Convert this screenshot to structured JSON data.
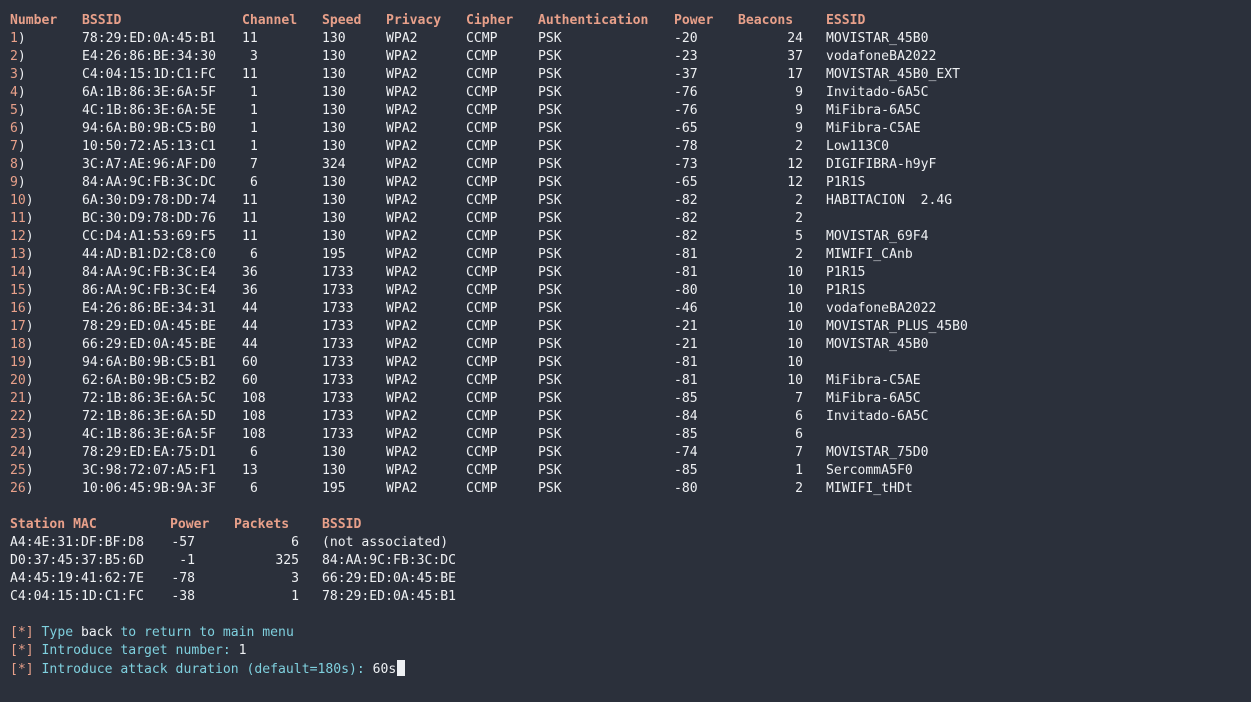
{
  "networks_header": {
    "number": "Number",
    "bssid": "BSSID",
    "channel": "Channel",
    "speed": "Speed",
    "privacy": "Privacy",
    "cipher": "Cipher",
    "authentication": "Authentication",
    "power": "Power",
    "beacons": "Beacons",
    "essid": "ESSID"
  },
  "networks": [
    {
      "number": "1",
      "bssid": "78:29:ED:0A:45:B1",
      "channel": "11",
      "speed": "130",
      "privacy": "WPA2",
      "cipher": "CCMP",
      "auth": "PSK",
      "power": "-20",
      "beacons": "24",
      "essid": "MOVISTAR_45B0"
    },
    {
      "number": "2",
      "bssid": "E4:26:86:BE:34:30",
      "channel": "3",
      "speed": "130",
      "privacy": "WPA2",
      "cipher": "CCMP",
      "auth": "PSK",
      "power": "-23",
      "beacons": "37",
      "essid": "vodafoneBA2022"
    },
    {
      "number": "3",
      "bssid": "C4:04:15:1D:C1:FC",
      "channel": "11",
      "speed": "130",
      "privacy": "WPA2",
      "cipher": "CCMP",
      "auth": "PSK",
      "power": "-37",
      "beacons": "17",
      "essid": "MOVISTAR_45B0_EXT"
    },
    {
      "number": "4",
      "bssid": "6A:1B:86:3E:6A:5F",
      "channel": "1",
      "speed": "130",
      "privacy": "WPA2",
      "cipher": "CCMP",
      "auth": "PSK",
      "power": "-76",
      "beacons": "9",
      "essid": "Invitado-6A5C"
    },
    {
      "number": "5",
      "bssid": "4C:1B:86:3E:6A:5E",
      "channel": "1",
      "speed": "130",
      "privacy": "WPA2",
      "cipher": "CCMP",
      "auth": "PSK",
      "power": "-76",
      "beacons": "9",
      "essid": "MiFibra-6A5C"
    },
    {
      "number": "6",
      "bssid": "94:6A:B0:9B:C5:B0",
      "channel": "1",
      "speed": "130",
      "privacy": "WPA2",
      "cipher": "CCMP",
      "auth": "PSK",
      "power": "-65",
      "beacons": "9",
      "essid": "MiFibra-C5AE"
    },
    {
      "number": "7",
      "bssid": "10:50:72:A5:13:C1",
      "channel": "1",
      "speed": "130",
      "privacy": "WPA2",
      "cipher": "CCMP",
      "auth": "PSK",
      "power": "-78",
      "beacons": "2",
      "essid": "Low113C0"
    },
    {
      "number": "8",
      "bssid": "3C:A7:AE:96:AF:D0",
      "channel": "7",
      "speed": "324",
      "privacy": "WPA2",
      "cipher": "CCMP",
      "auth": "PSK",
      "power": "-73",
      "beacons": "12",
      "essid": "DIGIFIBRA-h9yF"
    },
    {
      "number": "9",
      "bssid": "84:AA:9C:FB:3C:DC",
      "channel": "6",
      "speed": "130",
      "privacy": "WPA2",
      "cipher": "CCMP",
      "auth": "PSK",
      "power": "-65",
      "beacons": "12",
      "essid": "P1R1S"
    },
    {
      "number": "10",
      "bssid": "6A:30:D9:78:DD:74",
      "channel": "11",
      "speed": "130",
      "privacy": "WPA2",
      "cipher": "CCMP",
      "auth": "PSK",
      "power": "-82",
      "beacons": "2",
      "essid": "HABITACION  2.4G"
    },
    {
      "number": "11",
      "bssid": "BC:30:D9:78:DD:76",
      "channel": "11",
      "speed": "130",
      "privacy": "WPA2",
      "cipher": "CCMP",
      "auth": "PSK",
      "power": "-82",
      "beacons": "2",
      "essid": ""
    },
    {
      "number": "12",
      "bssid": "CC:D4:A1:53:69:F5",
      "channel": "11",
      "speed": "130",
      "privacy": "WPA2",
      "cipher": "CCMP",
      "auth": "PSK",
      "power": "-82",
      "beacons": "5",
      "essid": "MOVISTAR_69F4"
    },
    {
      "number": "13",
      "bssid": "44:AD:B1:D2:C8:C0",
      "channel": "6",
      "speed": "195",
      "privacy": "WPA2",
      "cipher": "CCMP",
      "auth": "PSK",
      "power": "-81",
      "beacons": "2",
      "essid": "MIWIFI_CAnb"
    },
    {
      "number": "14",
      "bssid": "84:AA:9C:FB:3C:E4",
      "channel": "36",
      "speed": "1733",
      "privacy": "WPA2",
      "cipher": "CCMP",
      "auth": "PSK",
      "power": "-81",
      "beacons": "10",
      "essid": "P1R15"
    },
    {
      "number": "15",
      "bssid": "86:AA:9C:FB:3C:E4",
      "channel": "36",
      "speed": "1733",
      "privacy": "WPA2",
      "cipher": "CCMP",
      "auth": "PSK",
      "power": "-80",
      "beacons": "10",
      "essid": "P1R1S"
    },
    {
      "number": "16",
      "bssid": "E4:26:86:BE:34:31",
      "channel": "44",
      "speed": "1733",
      "privacy": "WPA2",
      "cipher": "CCMP",
      "auth": "PSK",
      "power": "-46",
      "beacons": "10",
      "essid": "vodafoneBA2022"
    },
    {
      "number": "17",
      "bssid": "78:29:ED:0A:45:BE",
      "channel": "44",
      "speed": "1733",
      "privacy": "WPA2",
      "cipher": "CCMP",
      "auth": "PSK",
      "power": "-21",
      "beacons": "10",
      "essid": "MOVISTAR_PLUS_45B0"
    },
    {
      "number": "18",
      "bssid": "66:29:ED:0A:45:BE",
      "channel": "44",
      "speed": "1733",
      "privacy": "WPA2",
      "cipher": "CCMP",
      "auth": "PSK",
      "power": "-21",
      "beacons": "10",
      "essid": "MOVISTAR_45B0"
    },
    {
      "number": "19",
      "bssid": "94:6A:B0:9B:C5:B1",
      "channel": "60",
      "speed": "1733",
      "privacy": "WPA2",
      "cipher": "CCMP",
      "auth": "PSK",
      "power": "-81",
      "beacons": "10",
      "essid": ""
    },
    {
      "number": "20",
      "bssid": "62:6A:B0:9B:C5:B2",
      "channel": "60",
      "speed": "1733",
      "privacy": "WPA2",
      "cipher": "CCMP",
      "auth": "PSK",
      "power": "-81",
      "beacons": "10",
      "essid": "MiFibra-C5AE"
    },
    {
      "number": "21",
      "bssid": "72:1B:86:3E:6A:5C",
      "channel": "108",
      "speed": "1733",
      "privacy": "WPA2",
      "cipher": "CCMP",
      "auth": "PSK",
      "power": "-85",
      "beacons": "7",
      "essid": "MiFibra-6A5C"
    },
    {
      "number": "22",
      "bssid": "72:1B:86:3E:6A:5D",
      "channel": "108",
      "speed": "1733",
      "privacy": "WPA2",
      "cipher": "CCMP",
      "auth": "PSK",
      "power": "-84",
      "beacons": "6",
      "essid": "Invitado-6A5C"
    },
    {
      "number": "23",
      "bssid": "4C:1B:86:3E:6A:5F",
      "channel": "108",
      "speed": "1733",
      "privacy": "WPA2",
      "cipher": "CCMP",
      "auth": "PSK",
      "power": "-85",
      "beacons": "6",
      "essid": ""
    },
    {
      "number": "24",
      "bssid": "78:29:ED:EA:75:D1",
      "channel": "6",
      "speed": "130",
      "privacy": "WPA2",
      "cipher": "CCMP",
      "auth": "PSK",
      "power": "-74",
      "beacons": "7",
      "essid": "MOVISTAR_75D0"
    },
    {
      "number": "25",
      "bssid": "3C:98:72:07:A5:F1",
      "channel": "13",
      "speed": "130",
      "privacy": "WPA2",
      "cipher": "CCMP",
      "auth": "PSK",
      "power": "-85",
      "beacons": "1",
      "essid": "SercommA5F0"
    },
    {
      "number": "26",
      "bssid": "10:06:45:9B:9A:3F",
      "channel": "6",
      "speed": "195",
      "privacy": "WPA2",
      "cipher": "CCMP",
      "auth": "PSK",
      "power": "-80",
      "beacons": "2",
      "essid": "MIWIFI_tHDt"
    }
  ],
  "stations_header": {
    "station_mac": "Station MAC",
    "power": "Power",
    "packets": "Packets",
    "bssid": "BSSID"
  },
  "stations": [
    {
      "mac": "A4:4E:31:DF:BF:D8",
      "power": "-57",
      "packets": "6",
      "bssid": "(not associated)"
    },
    {
      "mac": "D0:37:45:37:B5:6D",
      "power": "-1",
      "packets": "325",
      "bssid": "84:AA:9C:FB:3C:DC"
    },
    {
      "mac": "A4:45:19:41:62:7E",
      "power": "-78",
      "packets": "3",
      "bssid": "66:29:ED:0A:45:BE"
    },
    {
      "mac": "C4:04:15:1D:C1:FC",
      "power": "-38",
      "packets": "1",
      "bssid": "78:29:ED:0A:45:B1"
    }
  ],
  "prompts": [
    {
      "marker": "[*]",
      "segments": [
        {
          "text": "Type ",
          "style": "cyan"
        },
        {
          "text": "back",
          "style": "white"
        },
        {
          "text": " to return to main menu",
          "style": "cyan"
        }
      ]
    },
    {
      "marker": "[*]",
      "segments": [
        {
          "text": "Introduce target number: ",
          "style": "cyan"
        },
        {
          "text": "1",
          "style": "white"
        }
      ]
    },
    {
      "marker": "[*]",
      "segments": [
        {
          "text": "Introduce attack duration (default=180s): ",
          "style": "cyan"
        },
        {
          "text": "60s",
          "style": "white"
        }
      ]
    }
  ],
  "colors": {
    "background": "#2b303b",
    "header_salmon": "#e8a08a",
    "prompt_cyan": "#7fd0de",
    "foreground": "#eef0f3"
  }
}
